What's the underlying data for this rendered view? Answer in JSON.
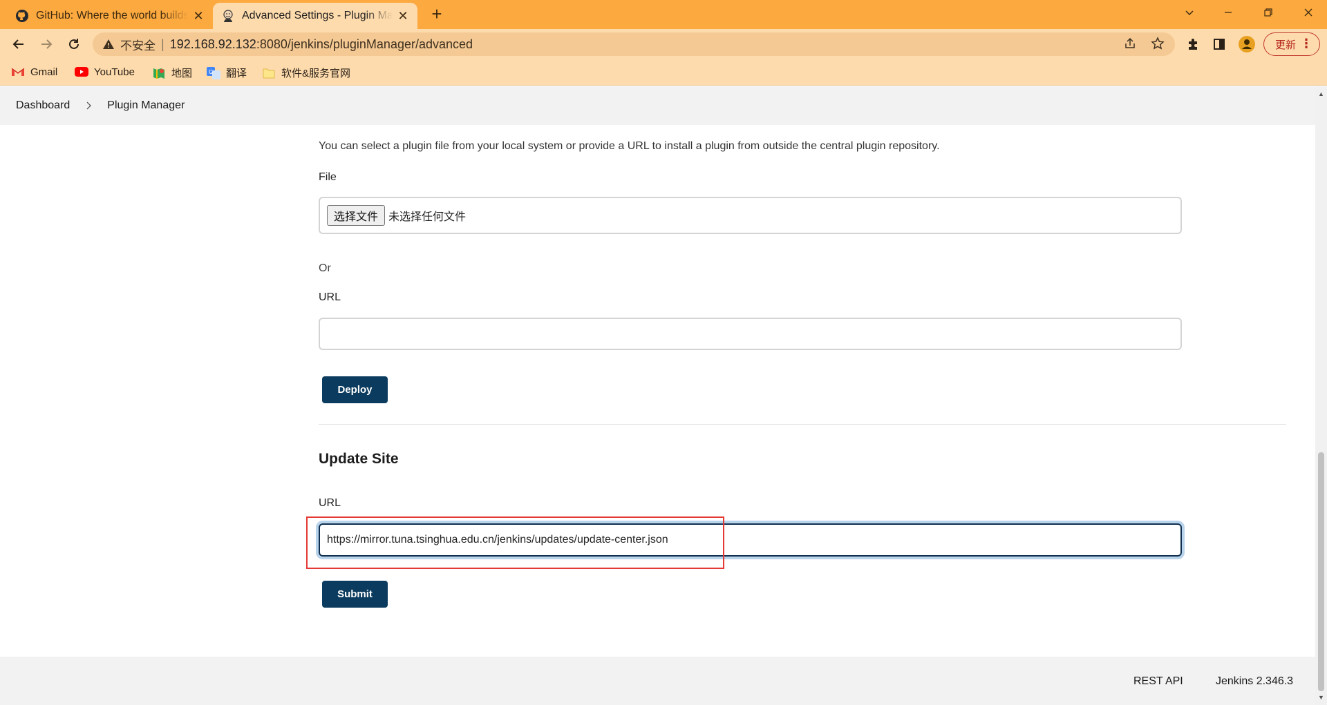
{
  "browser": {
    "tabs": [
      {
        "title": "GitHub: Where the world builds software",
        "icon": "github-icon",
        "active": false
      },
      {
        "title": "Advanced Settings - Plugin Manager",
        "icon": "jenkins-icon",
        "active": true
      }
    ],
    "new_tab": "+",
    "address": {
      "insecure_label": "不安全",
      "separator": "|",
      "host": "192.168.92.132",
      "path": ":8080/jenkins/pluginManager/advanced"
    },
    "update_button": "更新",
    "bookmarks": [
      {
        "label": "Gmail",
        "icon": "gmail-icon"
      },
      {
        "label": "YouTube",
        "icon": "youtube-icon"
      },
      {
        "label": "地图",
        "icon": "maps-icon"
      },
      {
        "label": "翻译",
        "icon": "translate-icon"
      },
      {
        "label": "软件&服务官网",
        "icon": "folder-icon"
      }
    ]
  },
  "breadcrumb": {
    "items": [
      "Dashboard",
      "Plugin Manager"
    ]
  },
  "deploy_plugin": {
    "description": "You can select a plugin file from your local system or provide a URL to install a plugin from outside the central plugin repository.",
    "file_label": "File",
    "choose_file_button": "选择文件",
    "no_file_text": "未选择任何文件",
    "or_text": "Or",
    "url_label": "URL",
    "url_value": "",
    "deploy_button": "Deploy"
  },
  "update_site": {
    "title": "Update Site",
    "url_label": "URL",
    "url_value": "https://mirror.tuna.tsinghua.edu.cn/jenkins/updates/update-center.json",
    "submit_button": "Submit"
  },
  "footer": {
    "rest_api": "REST API",
    "version": "Jenkins 2.346.3"
  },
  "colors": {
    "tabbar": "#fca93f",
    "toolbar": "#fedbac",
    "primary_button": "#0b3b5e",
    "highlight": "#e53935"
  }
}
